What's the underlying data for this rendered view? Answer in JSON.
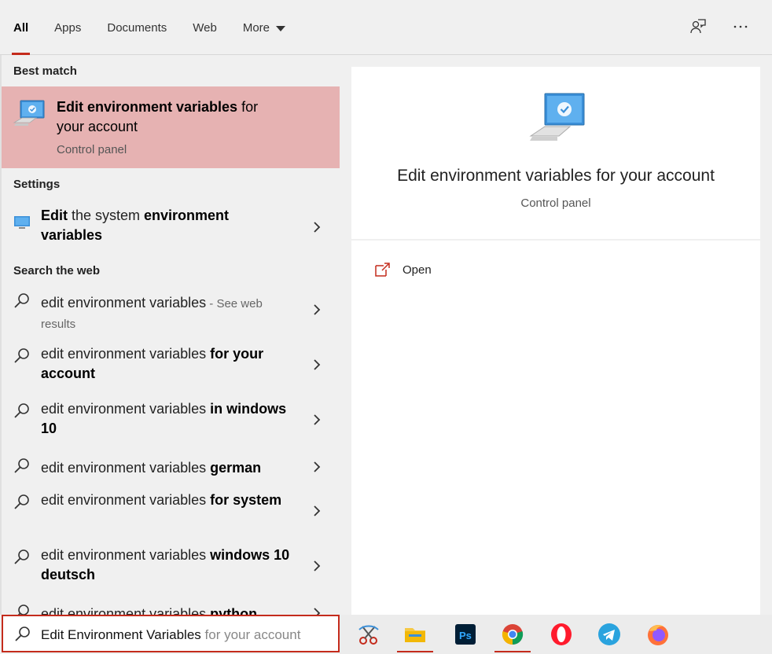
{
  "tabs": [
    {
      "label": "All"
    },
    {
      "label": "Apps"
    },
    {
      "label": "Documents"
    },
    {
      "label": "Web"
    },
    {
      "label": "More"
    }
  ],
  "top_actions": {
    "feedback_icon": "feedback-icon",
    "more_icon": "ellipsis-icon",
    "more_label": "···"
  },
  "sections": {
    "best_match": "Best match",
    "settings": "Settings",
    "search_web": "Search the web"
  },
  "best_match": {
    "title_bold": "Edit environment variables",
    "title_rest": " for your account",
    "subtitle": "Control panel",
    "icon": "computer-monitor-icon"
  },
  "settings_item": {
    "t1": "Edit",
    "t2": " the system ",
    "t3": "environment variables"
  },
  "web_results": [
    {
      "plain": "edit environment variables",
      "bold": "",
      "hint": " - See web results"
    },
    {
      "plain": "edit environment variables ",
      "bold": "for your account",
      "hint": ""
    },
    {
      "plain": "edit environment variables ",
      "bold": "in windows 10",
      "hint": ""
    },
    {
      "plain": "edit environment variables ",
      "bold": "german",
      "hint": ""
    },
    {
      "plain": "edit environment variables ",
      "bold": "for system",
      "hint": ""
    },
    {
      "plain": "edit environment variables ",
      "bold": "windows 10 deutsch",
      "hint": ""
    },
    {
      "plain": "edit environment variables ",
      "bold": "python",
      "hint": ""
    }
  ],
  "preview": {
    "title": "Edit environment variables for your account",
    "subtitle": "Control panel",
    "action_open": "Open"
  },
  "search": {
    "typed": "Edit Environment Variables",
    "suggestion": " for your account"
  },
  "taskbar": [
    {
      "name": "snipping-tool-icon",
      "open": false
    },
    {
      "name": "file-explorer-icon",
      "open": true
    },
    {
      "name": "photoshop-icon",
      "open": false,
      "label": "Ps"
    },
    {
      "name": "chrome-icon",
      "open": true
    },
    {
      "name": "opera-icon",
      "open": false
    },
    {
      "name": "telegram-icon",
      "open": false
    },
    {
      "name": "firefox-icon",
      "open": false
    }
  ],
  "colors": {
    "accent": "#c42b1c",
    "best_match_bg": "#e6b2b2",
    "pane_bg": "#f0f0f0"
  }
}
